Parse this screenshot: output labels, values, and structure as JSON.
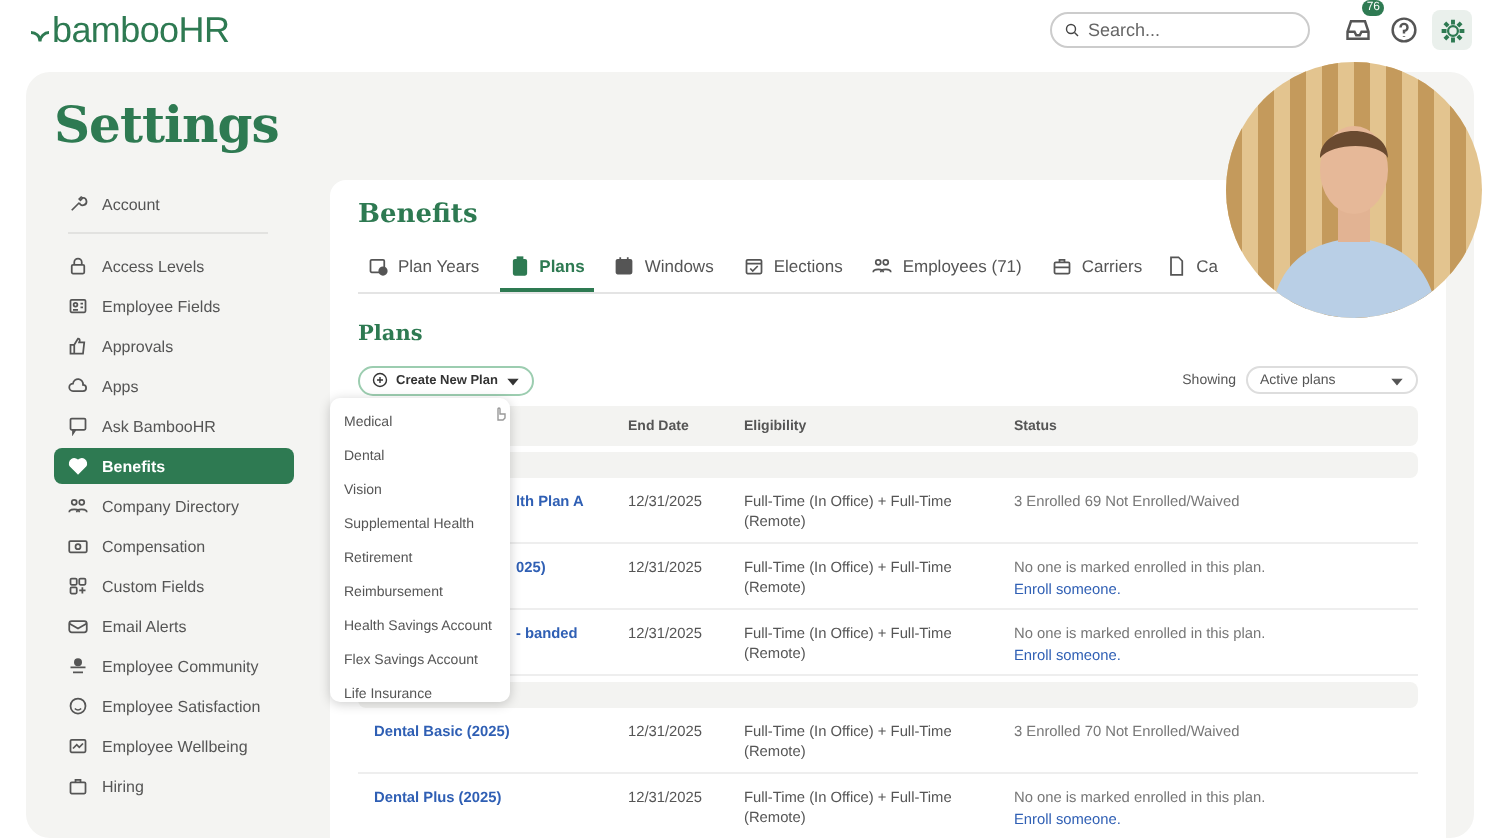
{
  "top_bar": {
    "logo": "bambooHR",
    "search": {
      "placeholder": "Search..."
    },
    "notification_count": "76"
  },
  "page_title": "Settings",
  "sidebar": {
    "items": [
      {
        "label": "Account",
        "selected": false
      },
      {
        "label": "Access Levels",
        "selected": false
      },
      {
        "label": "Employee Fields",
        "selected": false
      },
      {
        "label": "Approvals",
        "selected": false
      },
      {
        "label": "Apps",
        "selected": false
      },
      {
        "label": "Ask BambooHR",
        "selected": false
      },
      {
        "label": "Benefits",
        "selected": true
      },
      {
        "label": "Company Directory",
        "selected": false
      },
      {
        "label": "Compensation",
        "selected": false
      },
      {
        "label": "Custom Fields",
        "selected": false
      },
      {
        "label": "Email Alerts",
        "selected": false
      },
      {
        "label": "Employee Community",
        "selected": false
      },
      {
        "label": "Employee Satisfaction",
        "selected": false
      },
      {
        "label": "Employee Wellbeing",
        "selected": false
      },
      {
        "label": "Hiring",
        "selected": false
      }
    ]
  },
  "panel": {
    "title": "Benefits",
    "tabs": [
      {
        "label": "Plan Years",
        "selected": false
      },
      {
        "label": "Plans",
        "selected": true
      },
      {
        "label": "Windows",
        "selected": false
      },
      {
        "label": "Elections",
        "selected": false
      },
      {
        "label": "Employees (71)",
        "selected": false
      },
      {
        "label": "Carriers",
        "selected": false
      },
      {
        "label": "Ca",
        "selected": false
      }
    ],
    "section_title": "Plans",
    "create_button": "Create New Plan",
    "showing_label": "Showing",
    "showing_select": "Active plans",
    "menu": {
      "items": [
        "Medical",
        "Dental",
        "Vision",
        "Supplemental Health",
        "Retirement",
        "Reimbursement",
        "Health Savings Account",
        "Flex Savings Account",
        "Life Insurance"
      ]
    },
    "table": {
      "columns": [
        "End Date",
        "Eligibility",
        "Status"
      ],
      "rows": [
        {
          "kind": "group"
        },
        {
          "kind": "covered",
          "name": "lth Plan A",
          "end_date": "12/31/2025",
          "eligibility": "Full-Time (In Office) + Full-Time (Remote)",
          "status": "3 Enrolled 69 Not Enrolled/Waived"
        },
        {
          "kind": "covered",
          "name": "025)",
          "end_date": "12/31/2025",
          "eligibility": "Full-Time (In Office) + Full-Time (Remote)",
          "status": "No one is marked enrolled in this plan.",
          "link": "Enroll someone."
        },
        {
          "kind": "covered",
          "name": "- banded",
          "end_date": "12/31/2025",
          "eligibility": "Full-Time (In Office) + Full-Time (Remote)",
          "status": "No one is marked enrolled in this plan.",
          "link": "Enroll someone."
        },
        {
          "kind": "group"
        },
        {
          "kind": "plan",
          "name": "Dental Basic (2025)",
          "end_date": "12/31/2025",
          "eligibility": "Full-Time (In Office) + Full-Time (Remote)",
          "status": "3 Enrolled 70 Not Enrolled/Waived"
        },
        {
          "kind": "plan",
          "name": "Dental Plus (2025)",
          "end_date": "12/31/2025",
          "eligibility": "Full-Time (In Office) + Full-Time (Remote)",
          "status": "No one is marked enrolled in this plan.",
          "link": "Enroll someone."
        }
      ]
    }
  }
}
